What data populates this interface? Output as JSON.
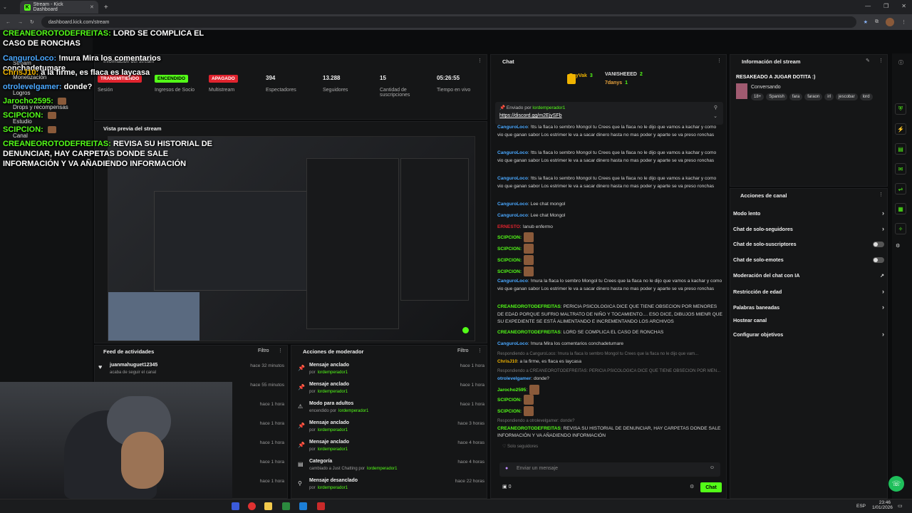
{
  "browser": {
    "tab_title": "Stream - Kick Dashboard",
    "new_tab": "+",
    "url": "dashboard.kick.com/stream"
  },
  "overlay_chat": [
    {
      "user": "CREANEOROTODEFREITAS:",
      "text": "LORD SE COMPLICA EL CASO DE RONCHAS",
      "color": "#53fc18"
    },
    {
      "user": "CanguroLoco:",
      "text": "!mura Mira los comentarios conchadetumare",
      "color": "#4aa8ff"
    },
    {
      "user": "ChrisJ10:",
      "text": "a la firme, es flaca es laycasa",
      "color": "#f0b400"
    },
    {
      "user": "otrolevelgamer:",
      "text": "donde?",
      "color": "#4aa8ff"
    },
    {
      "user": "Jarocho2595:",
      "text": "",
      "color": "#53fc18"
    },
    {
      "user": "SCIPCION:",
      "text": "",
      "color": "#53fc18"
    },
    {
      "user": "SCIPCION:",
      "text": "",
      "color": "#53fc18"
    },
    {
      "user": "CREANEOROTODEFREITAS:",
      "text": "REVISA SU HISTORIAL DE DENUNCIAR, HAY CARPETAS DONDE SALE INFORMACIÓN Y VA AÑADIENDO INFORMACIÓN",
      "color": "#53fc18"
    }
  ],
  "sidebar": {
    "items": [
      "Stream",
      "Monetización",
      "Logros",
      "Drops y recompensas",
      "Estudio",
      "Canal"
    ]
  },
  "stream_info_panel": {
    "title": "Información del stream",
    "stats": [
      {
        "value": "TRANSMITIENDO",
        "label": "Sesión",
        "badge_color": "#e0232e"
      },
      {
        "value": "ENCENDIDO",
        "label": "Ingresos de Socio",
        "badge_color": "#53fc18"
      },
      {
        "value": "APAGADO",
        "label": "Multistream",
        "badge_color": "#e0232e"
      },
      {
        "value": "394",
        "label": "Espectadores"
      },
      {
        "value": "13.288",
        "label": "Seguidores"
      },
      {
        "value": "15",
        "label": "Cantidad de suscripciones"
      },
      {
        "value": "05:26:55",
        "label": "Tiempo en vivo"
      }
    ]
  },
  "preview": {
    "title": "Vista previa del stream"
  },
  "activity_feed": {
    "title": "Feed de actividades",
    "filter": "Filtro",
    "rows": [
      {
        "user": "juanmahuguet12345",
        "sub": "acaba de seguir el canal",
        "time": "hace 32 minutos"
      },
      {
        "user": "",
        "sub": "",
        "time": "hace 55 minutos"
      },
      {
        "user": "",
        "sub": "",
        "time": "hace 1 hora"
      },
      {
        "user": "",
        "sub": "",
        "time": "hace 1 hora"
      },
      {
        "user": "",
        "sub": "",
        "time": "hace 1 hora"
      },
      {
        "user": "",
        "sub": "",
        "time": "hace 1 hora"
      },
      {
        "user": "",
        "sub": "",
        "time": "hace 1 hora"
      }
    ]
  },
  "mod_actions": {
    "title": "Acciones de moderador",
    "filter": "Filtro",
    "rows": [
      {
        "title": "Mensaje anclado",
        "sub": "por",
        "user": "lordemperador1",
        "time": "hace 1 hora",
        "icon": "pin-icon"
      },
      {
        "title": "Mensaje anclado",
        "sub": "por",
        "user": "lordemperador1",
        "time": "hace 1 hora",
        "icon": "pin-icon"
      },
      {
        "title": "Modo para adultos",
        "sub": "encendido por",
        "user": "lordemperador1",
        "time": "hace 1 hora",
        "icon": "adult-icon"
      },
      {
        "title": "Mensaje anclado",
        "sub": "por",
        "user": "lordemperador1",
        "time": "hace 3 horas",
        "icon": "pin-icon"
      },
      {
        "title": "Mensaje anclado",
        "sub": "por",
        "user": "lordemperador1",
        "time": "hace 4 horas",
        "icon": "pin-icon"
      },
      {
        "title": "Categoría",
        "sub": "cambiado a Just Chatting por",
        "user": "lordemperador1",
        "time": "hace 4 horas",
        "icon": "category-icon"
      },
      {
        "title": "Mensaje desanclado",
        "sub": "por",
        "user": "lordemperador1",
        "time": "hace 22 horas",
        "icon": "unpin-icon"
      }
    ]
  },
  "chat": {
    "title": "Chat",
    "leaders": [
      {
        "name": "RayVak",
        "count": "3"
      },
      {
        "name": "VANISHEEED",
        "count": "2"
      },
      {
        "name": "7danys",
        "count": "1"
      }
    ],
    "pinned": {
      "by_label": "Enviado por",
      "by_user": "lordemperador1",
      "link": "https://discord.gg/m2EjySFb"
    },
    "messages": [
      {
        "user": "CanguroLoco",
        "text": ": !tts la flaca lo sembro Mongol tu Crees que la flaca no le dijo que vamos a kachar y como vio que ganan sabor Los estrimer le va a sacar dinero hasta no mas poder y aparte se va preso ronchas",
        "color": "#4aa8ff"
      },
      {
        "user": "CanguroLoco",
        "text": ": !tts la flaca lo sembro Mongol tu Crees que la flaca no le dijo que vamos a kachar y como vio que ganan sabor Los estrimer le va a sacar dinero hasta no mas poder y aparte se va preso ronchas",
        "color": "#4aa8ff"
      },
      {
        "user": "CanguroLoco",
        "text": ": !tts la flaca lo sembro Mongol tu Crees que la flaca no le dijo que vamos a kachar y como vio que ganan sabor Los estrimer le va a sacar dinero hasta no mas poder y aparte se va preso ronchas",
        "color": "#4aa8ff"
      },
      {
        "user": "CanguroLoco",
        "text": ": Lee chat mongol",
        "color": "#4aa8ff"
      },
      {
        "user": "CanguroLoco",
        "text": ": Lee chat Mongol",
        "color": "#4aa8ff"
      },
      {
        "user": "ERNESTO",
        "text": ": !anub enfermo",
        "color": "#e0232e"
      },
      {
        "user": "SCIPCION:",
        "text": "",
        "color": "#53fc18"
      },
      {
        "user": "SCIPCION:",
        "text": "",
        "color": "#53fc18"
      },
      {
        "user": "SCIPCION:",
        "text": "",
        "color": "#53fc18"
      },
      {
        "user": "SCIPCION:",
        "text": "",
        "color": "#53fc18"
      },
      {
        "user": "CanguroLoco",
        "text": ": !mura la flaca lo sembro Mongol tu Crees que la flaca no le dijo que vamos a kachar y como vio que ganan sabor Los estrimer le va a sacar dinero hasta no mas poder y aparte se va preso ronchas",
        "color": "#4aa8ff"
      },
      {
        "user": "CREANEOROTODEFREITAS",
        "text": ": PERICIA PSICOLOGICA DICE QUE TIENE OBSECION POR MENORES DE EDAD PORQUE SUFRIO MALTRATO DE NIÑO Y TOCAMIENTO.... ESO DICE, DIBUJOS MIENR QUE SU EXPEDIENTE SE ESTÁ ALIMENTANDO E INCREMENTANDO LOS ARCHIVOS",
        "color": "#53fc18"
      },
      {
        "user": "CREANEOROTODEFREITAS",
        "text": ": LORD SE COMPLICA EL CASO DE RONCHAS",
        "color": "#53fc18"
      },
      {
        "user": "CanguroLoco",
        "text": ": !mura Mira los comentarios conchadetumare",
        "color": "#4aa8ff"
      },
      {
        "reply": "Respondiendo a CanguroLoco: !mura la flaca lo sembro Mongol tu Crees que la flaca no le dijo que vam...",
        "user": "ChrisJ10",
        "text": ": a la firme, es flaca es laycasa",
        "color": "#f0b400"
      },
      {
        "reply": "Respondiendo a CREANEOROTODEFREITAS: PERICIA PSICOLOGICA DICE QUE TIENE OBSECION POR MEN...",
        "user": "otrolevelgamer",
        "text": ": donde?",
        "color": "#4aa8ff"
      },
      {
        "user": "Jarocho2595",
        "text": ":",
        "color": "#53fc18"
      },
      {
        "user": "SCIPCION:",
        "text": "",
        "color": "#53fc18"
      },
      {
        "user": "SCIPCION:",
        "text": "",
        "color": "#53fc18"
      },
      {
        "reply": "Respondiendo a otrolevelgamer: donde?",
        "user": "CREANEOROTODEFREITAS",
        "text": ": REVISA SU HISTORIAL DE DENUNCIAR, HAY CARPETAS DONDE SALE INFORMACIÓN Y VA AÑADIENDO INFORMACIÓN",
        "color": "#53fc18"
      }
    ],
    "followers_only": "Solo seguidores",
    "input_placeholder": "Enviar un mensaje",
    "points": "0",
    "send_button": "Chat"
  },
  "stream_details": {
    "title": "Información del stream",
    "stream_title": "RESAKEADO A JUGAR DOTITA :)",
    "category": "Conversando",
    "tags": [
      "18+",
      "Spanish",
      "fara",
      "faraon",
      "irl",
      "jescobar",
      "lord"
    ]
  },
  "channel_actions": {
    "title": "Acciones de canal",
    "items": [
      {
        "label": "Modo lento",
        "control": "chevron"
      },
      {
        "label": "Chat de solo-seguidores",
        "control": "chevron"
      },
      {
        "label": "Chat de solo-suscriptores",
        "control": "toggle"
      },
      {
        "label": "Chat de solo-emotes",
        "control": "toggle"
      },
      {
        "label": "Moderación del chat con IA",
        "control": "external"
      },
      {
        "label": "Restricción de edad",
        "control": "chevron"
      },
      {
        "label": "Palabras baneadas",
        "control": "chevron"
      },
      {
        "label": "Hostear canal",
        "control": "none"
      },
      {
        "label": "Configurar objetivos",
        "control": "chevron"
      }
    ]
  },
  "taskbar": {
    "lang": "ESP",
    "time": "23:46",
    "date": "1/01/2026"
  },
  "colors": {
    "accent": "#53fc18",
    "live_red": "#e0232e",
    "panel": "#151617"
  }
}
